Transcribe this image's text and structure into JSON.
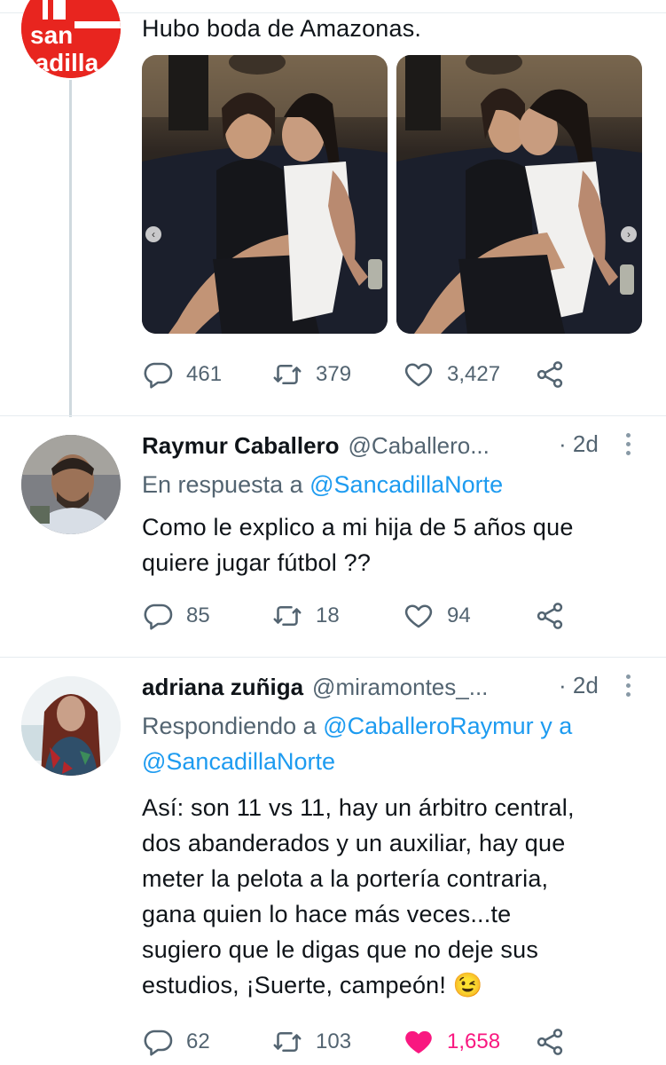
{
  "main_tweet": {
    "text": "Hubo boda de Amazonas.",
    "avatar_text": "san\ncadilla",
    "stats": {
      "replies": "461",
      "retweets": "379",
      "likes": "3,427"
    }
  },
  "reply1": {
    "name": "Raymur Caballero",
    "handle": "@Caballero...",
    "time": "· 2d",
    "reply_prefix": "En respuesta a",
    "reply_to": "@SancadillaNorte",
    "text_line1": "Como le explico a mi hija de 5 años que",
    "text_line2": "quiere jugar fútbol ??",
    "stats": {
      "replies": "85",
      "retweets": "18",
      "likes": "94"
    }
  },
  "reply2": {
    "name": "adriana zuñiga",
    "handle": "@miramontes_...",
    "time": "· 2d",
    "reply_prefix": "Respondiendo a",
    "reply_to_1": "@CaballeroRaymur",
    "reply_and": "y a",
    "reply_to_2": "@SancadillaNorte",
    "text_lines": [
      "Así: son 11 vs 11, hay un árbitro central,",
      "dos abanderados y un auxiliar, hay que",
      "meter la pelota a la portería contraria,",
      "gana quien lo hace más veces...te",
      "sugiero que le digas que no deje sus",
      "estudios, ¡Suerte, campeón! 😉"
    ],
    "stats": {
      "replies": "62",
      "retweets": "103",
      "likes": "1,658"
    }
  },
  "icons": {
    "reply": "reply-icon",
    "retweet": "retweet-icon",
    "like": "heart-icon",
    "share": "share-icon"
  },
  "colors": {
    "link": "#1d9bf0",
    "muted": "#536471",
    "liked": "#f91880",
    "brand_red": "#e8251f"
  }
}
